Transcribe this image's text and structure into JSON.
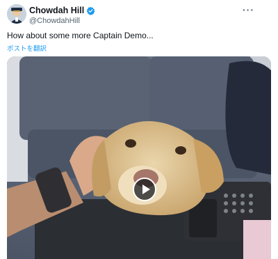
{
  "tweet": {
    "display_name": "Chowdah Hill",
    "handle": "@ChowdahHill",
    "text": "How about some more Captain Demo...",
    "translate_label": "ポストを翻訳",
    "more_icon": "more-horizontal-icon",
    "verified_icon": "verified-badge-icon",
    "verified_color": "#1d9bf0"
  },
  "media": {
    "type": "video",
    "play_icon": "play-icon"
  },
  "colors": {
    "text_primary": "#0f1419",
    "text_secondary": "#536471",
    "link": "#1d9bf0"
  }
}
